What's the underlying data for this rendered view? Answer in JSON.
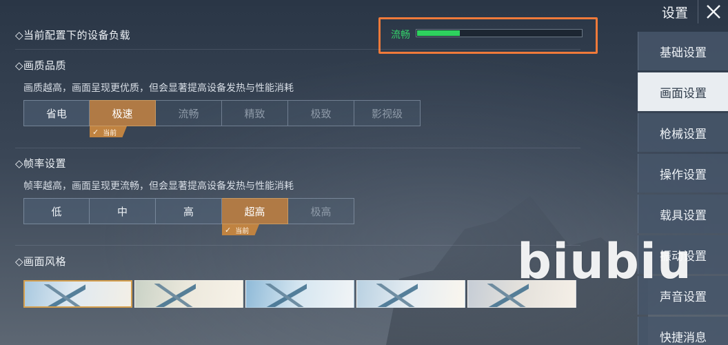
{
  "header": {
    "title": "设置",
    "close_icon": "close-icon"
  },
  "load": {
    "title": "◇当前配置下的设备负载",
    "status_label": "流畅",
    "level": 0.26,
    "status_color": "#2ed15e",
    "highlight_color": "#f07a3a"
  },
  "quality": {
    "title": "◇画质品质",
    "description": "画质越高，画面呈现更优质，但会显著提高设备发热与性能消耗",
    "options": [
      "省电",
      "极速",
      "流畅",
      "精致",
      "极致",
      "影视级"
    ],
    "selected": "极速",
    "disabled": [
      "流畅",
      "精致",
      "极致",
      "影视级"
    ],
    "current_tag": "当前"
  },
  "framerate": {
    "title": "◇帧率设置",
    "description": "帧率越高，画面呈现更流畅，但会显著提高设备发热与性能消耗",
    "options": [
      "低",
      "中",
      "高",
      "超高",
      "极高"
    ],
    "selected": "超高",
    "disabled": [
      "极高"
    ],
    "current_tag": "当前"
  },
  "style": {
    "title": "◇画面风格",
    "thumbnail_count": 5,
    "selected_index": 0
  },
  "sidebar": {
    "items": [
      {
        "label": "基础设置",
        "active": false
      },
      {
        "label": "画面设置",
        "active": true
      },
      {
        "label": "枪械设置",
        "active": false
      },
      {
        "label": "操作设置",
        "active": false
      },
      {
        "label": "载具设置",
        "active": false
      },
      {
        "label": "振动设置",
        "active": false
      },
      {
        "label": "声音设置",
        "active": false
      },
      {
        "label": "快捷消息",
        "active": false
      }
    ]
  },
  "watermark": "biubiu",
  "colors": {
    "accent": "#b07a45",
    "accent_tag": "#c08341",
    "active_tab_bg": "#e9edf1"
  }
}
